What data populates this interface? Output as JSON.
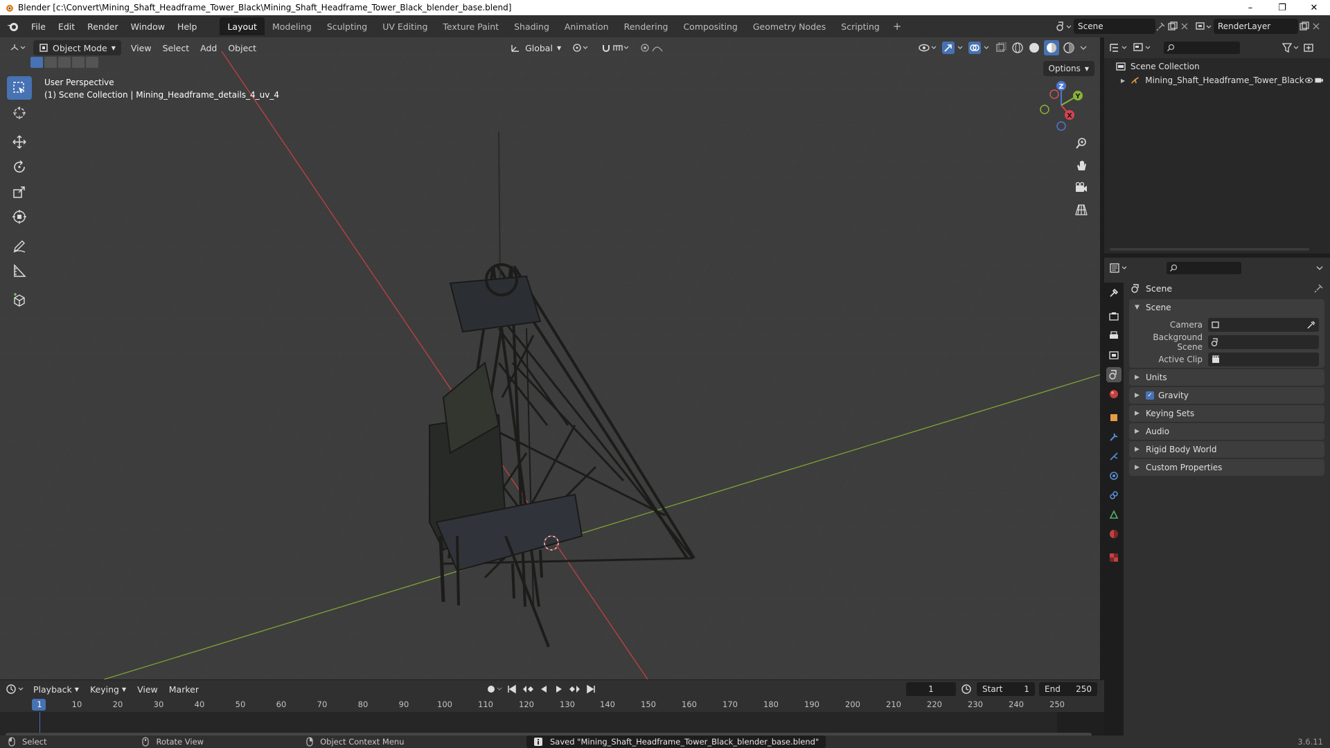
{
  "window": {
    "title": "Blender [c:\\Convert\\Mining_Shaft_Headframe_Tower_Black\\Mining_Shaft_Headframe_Tower_Black_blender_base.blend]",
    "minimize": "–",
    "maximize": "❐",
    "close": "✕"
  },
  "menu": [
    "File",
    "Edit",
    "Render",
    "Window",
    "Help"
  ],
  "workspaces": [
    "Layout",
    "Modeling",
    "Sculpting",
    "UV Editing",
    "Texture Paint",
    "Shading",
    "Animation",
    "Rendering",
    "Compositing",
    "Geometry Nodes",
    "Scripting"
  ],
  "workspace_add": "+",
  "scene_selector": {
    "value": "Scene"
  },
  "view_layer": {
    "value": "RenderLayer"
  },
  "viewport": {
    "mode": "Object Mode",
    "menus": [
      "View",
      "Select",
      "Add",
      "Object"
    ],
    "transform_orientation": "Global",
    "options": "Options",
    "perspective_label": "User Perspective",
    "collection_label": "(1) Scene Collection | Mining_Headframe_details_4_uv_4",
    "gizmo": {
      "x": "X",
      "y": "Y",
      "z": "Z"
    }
  },
  "outliner": {
    "root": "Scene Collection",
    "items": [
      {
        "name": "Mining_Shaft_Headframe_Tower_Black"
      }
    ]
  },
  "properties": {
    "context": "Scene",
    "section": "Scene",
    "fields": [
      {
        "label": "Camera",
        "value": ""
      },
      {
        "label": "Background Scene",
        "value": ""
      },
      {
        "label": "Active Clip",
        "value": ""
      }
    ],
    "panels": [
      "Units",
      "Gravity",
      "Keying Sets",
      "Audio",
      "Rigid Body World",
      "Custom Properties"
    ],
    "gravity_checked": true
  },
  "timeline": {
    "menus": [
      "Playback",
      "Keying",
      "View",
      "Marker"
    ],
    "current_frame": "1",
    "start_label": "Start",
    "start": "1",
    "end_label": "End",
    "end": "250",
    "ticks": [
      "1",
      "10",
      "20",
      "30",
      "40",
      "50",
      "60",
      "70",
      "80",
      "90",
      "100",
      "110",
      "120",
      "130",
      "140",
      "150",
      "160",
      "170",
      "180",
      "190",
      "200",
      "210",
      "220",
      "230",
      "240",
      "250"
    ]
  },
  "status": {
    "select": "Select",
    "rotate": "Rotate View",
    "context_menu": "Object Context Menu",
    "message": "Saved \"Mining_Shaft_Headframe_Tower_Black_blender_base.blend\"",
    "version": "3.6.11"
  }
}
